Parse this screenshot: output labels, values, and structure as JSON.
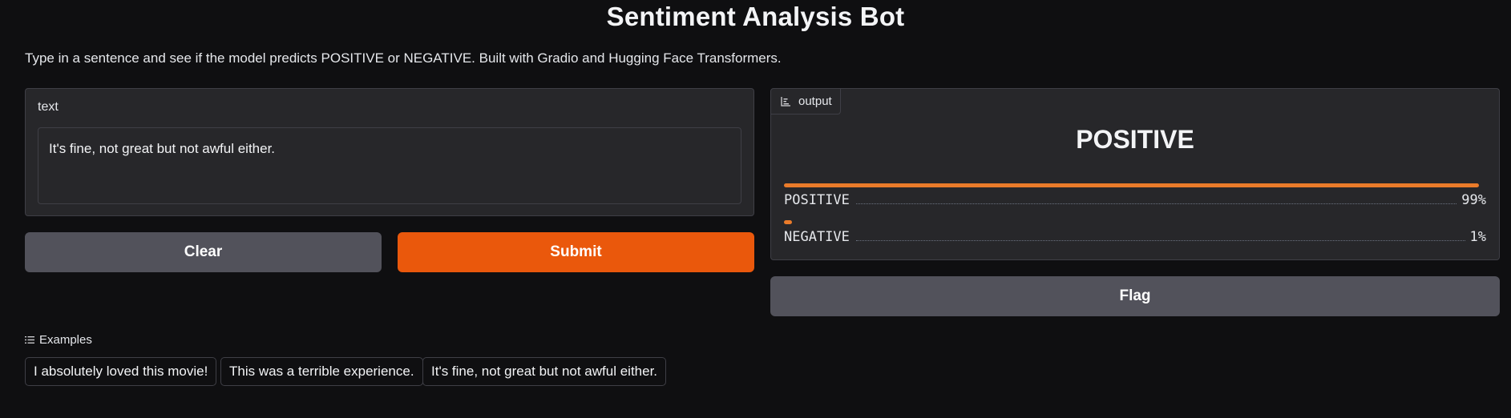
{
  "app": {
    "title": "Sentiment Analysis Bot",
    "description": "Type in a sentence and see if the model predicts POSITIVE or NEGATIVE. Built with Gradio and Hugging Face Transformers."
  },
  "input": {
    "label": "text",
    "value": "It's fine, not great but not awful either."
  },
  "buttons": {
    "clear": "Clear",
    "submit": "Submit",
    "flag": "Flag"
  },
  "output": {
    "tag_label": "output",
    "predicted_label": "POSITIVE",
    "confidences": [
      {
        "label": "POSITIVE",
        "percent_text": "99%",
        "value": 0.99
      },
      {
        "label": "NEGATIVE",
        "percent_text": "1%",
        "value": 0.01
      }
    ]
  },
  "examples": {
    "header": "Examples",
    "items": [
      "I absolutely loved this movie!",
      "This was a terrible experience.",
      "It's fine, not great but not awful either."
    ]
  },
  "colors": {
    "accent": "#ea580c",
    "bar": "#ea7b2a",
    "background": "#0f0f11",
    "panel": "#27272a",
    "secondary_button": "#52525b"
  },
  "icons": {
    "output_tag": "bar-chart-icon",
    "examples": "list-icon"
  }
}
